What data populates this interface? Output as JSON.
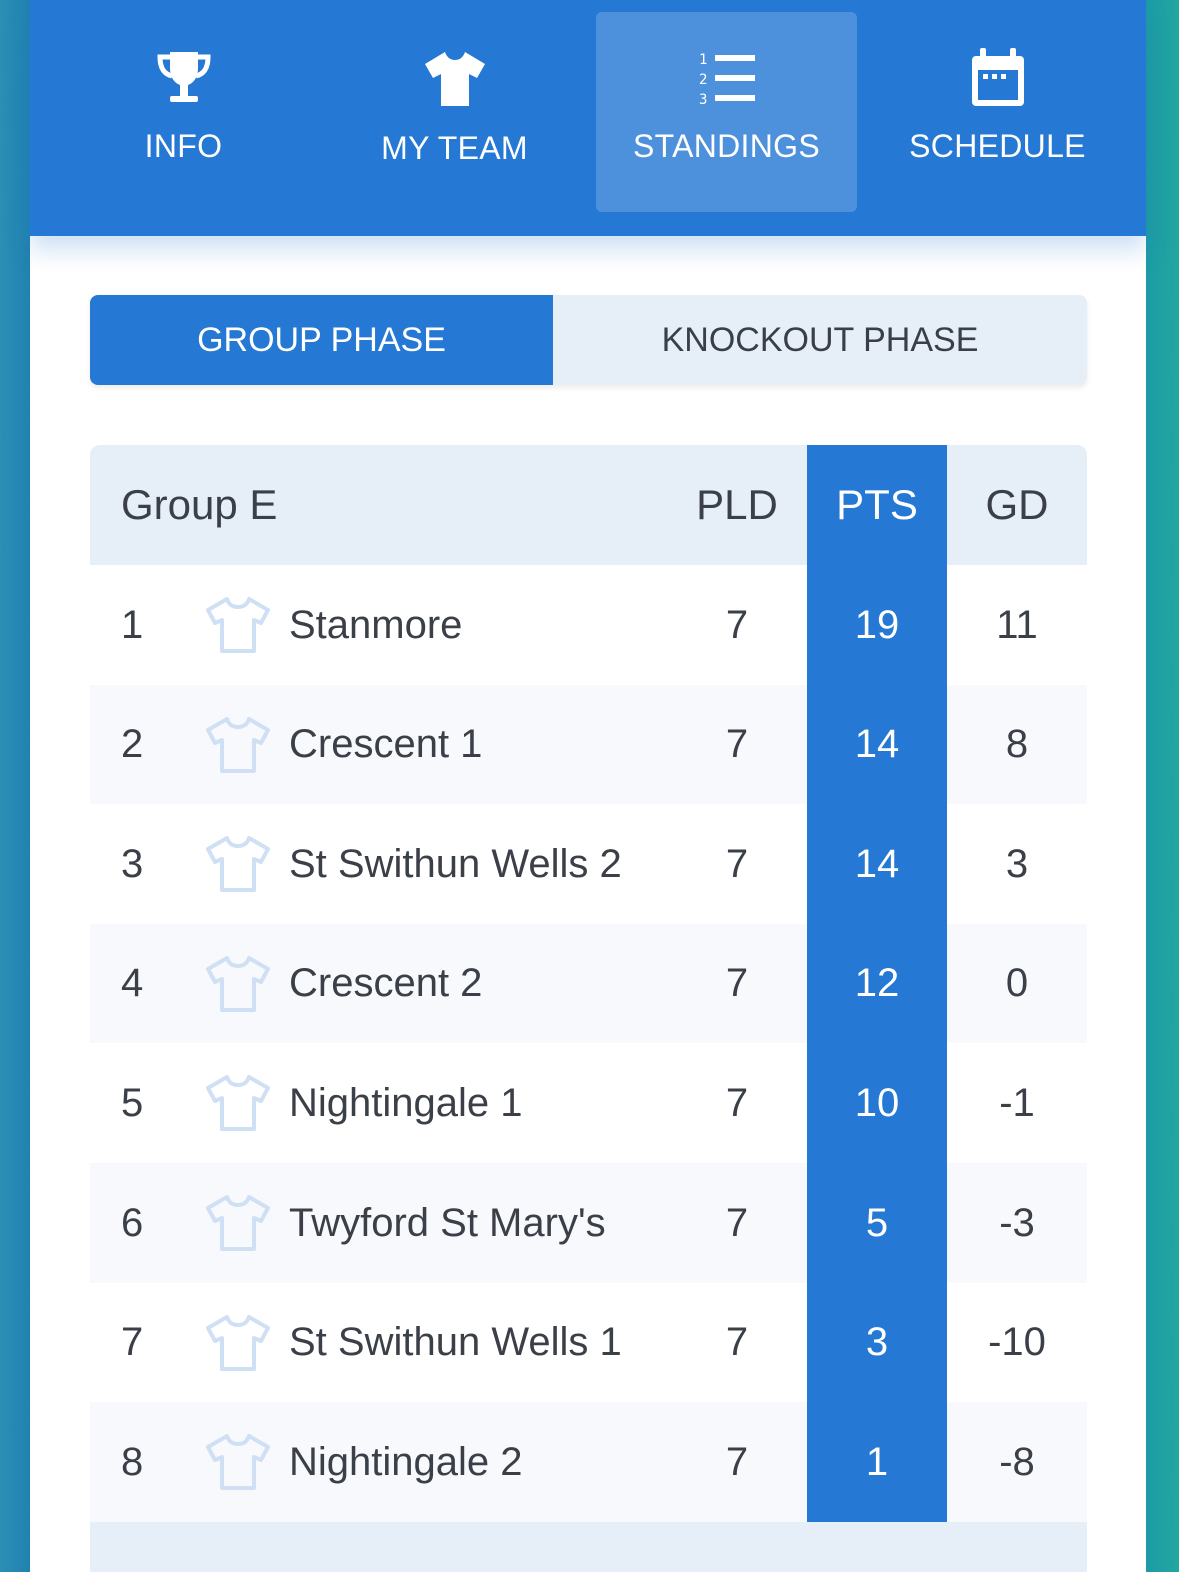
{
  "nav": {
    "items": [
      {
        "label": "INFO",
        "icon": "trophy-icon"
      },
      {
        "label": "MY TEAM",
        "icon": "shirt-icon"
      },
      {
        "label": "STANDINGS",
        "icon": "numbered-list-icon",
        "active": true
      },
      {
        "label": "SCHEDULE",
        "icon": "calendar-icon"
      }
    ]
  },
  "phase": {
    "group_label": "GROUP PHASE",
    "knockout_label": "KNOCKOUT PHASE",
    "selected": "GROUP PHASE"
  },
  "table": {
    "group_name": "Group E",
    "columns": {
      "pld": "PLD",
      "pts": "PTS",
      "gd": "GD"
    },
    "rows": [
      {
        "pos": "1",
        "team": "Stanmore",
        "pld": "7",
        "pts": "19",
        "gd": "11"
      },
      {
        "pos": "2",
        "team": "Crescent 1",
        "pld": "7",
        "pts": "14",
        "gd": "8"
      },
      {
        "pos": "3",
        "team": "St Swithun Wells 2",
        "pld": "7",
        "pts": "14",
        "gd": "3"
      },
      {
        "pos": "4",
        "team": "Crescent 2",
        "pld": "7",
        "pts": "12",
        "gd": "0"
      },
      {
        "pos": "5",
        "team": "Nightingale 1",
        "pld": "7",
        "pts": "10",
        "gd": "-1"
      },
      {
        "pos": "6",
        "team": "Twyford St Mary's",
        "pld": "7",
        "pts": "5",
        "gd": "-3"
      },
      {
        "pos": "7",
        "team": "St Swithun Wells 1",
        "pld": "7",
        "pts": "3",
        "gd": "-10"
      },
      {
        "pos": "8",
        "team": "Nightingale 2",
        "pld": "7",
        "pts": "1",
        "gd": "-8"
      }
    ]
  },
  "colors": {
    "primary": "#2578d3",
    "active_tab": "#4d91dc",
    "header_bg": "#e6eef8",
    "shirt": "#cfe0f5",
    "text": "#3b4048"
  }
}
